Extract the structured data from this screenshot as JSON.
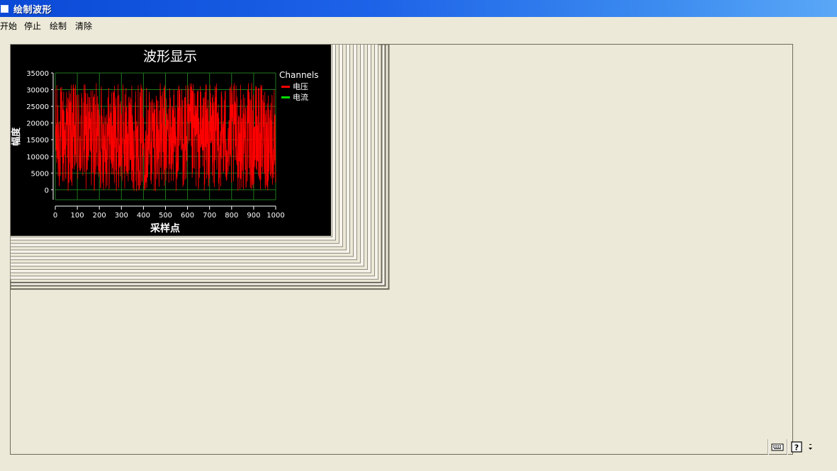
{
  "window": {
    "title": "绘制波形"
  },
  "menu": {
    "items": [
      {
        "label": "开始"
      },
      {
        "label": "停止"
      },
      {
        "label": "绘制"
      },
      {
        "label": "清除"
      }
    ]
  },
  "chart_data": {
    "type": "line",
    "title": "波形显示",
    "xlabel": "采样点",
    "ylabel": "幅度",
    "xlim": [
      0,
      1000
    ],
    "ylim": [
      -3000,
      35000
    ],
    "xticks": [
      0,
      100,
      200,
      300,
      400,
      500,
      600,
      700,
      800,
      900,
      1000
    ],
    "yticks": [
      0,
      5000,
      10000,
      15000,
      20000,
      25000,
      30000,
      35000
    ],
    "grid": true,
    "legend_title": "Channels",
    "legend_position": "right",
    "series": [
      {
        "name": "电压",
        "color": "#ff0000",
        "pattern": "random noise between approx -500 and 32000 over 1000 samples"
      },
      {
        "name": "电流",
        "color": "#00dd00",
        "pattern": "not visible (overdrawn)"
      }
    ],
    "colors": {
      "background": "#000000",
      "grid": "#1f7a1f",
      "axis": "#ffffff"
    }
  },
  "status_bar": {
    "icons": [
      {
        "name": "keyboard-icon"
      },
      {
        "name": "help-icon"
      },
      {
        "name": "overflow-chevron-icon"
      }
    ]
  }
}
